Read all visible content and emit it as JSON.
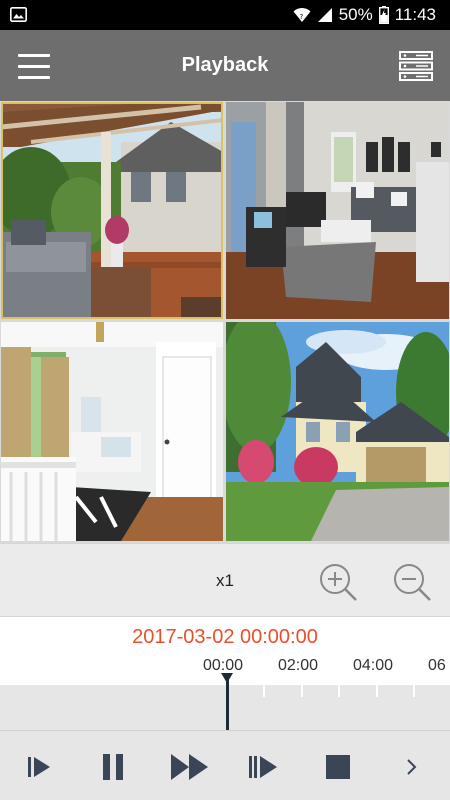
{
  "status_bar": {
    "battery_percent": "50%",
    "time": "11:43",
    "left_icon": "image-icon",
    "icons": [
      "wifi-icon",
      "signal-icon",
      "battery-icon"
    ]
  },
  "app_bar": {
    "title": "Playback",
    "menu_icon": "hamburger-menu-icon",
    "device_icon": "dvr-device-icon"
  },
  "grid": {
    "channels": [
      {
        "scene": "patio pergola"
      },
      {
        "scene": "living room"
      },
      {
        "scene": "bedroom"
      },
      {
        "scene": "house exterior"
      }
    ],
    "active_channel": 1
  },
  "controls": {
    "speed": "x1",
    "zoom_in_icon": "zoom-in-icon",
    "zoom_out_icon": "zoom-out-icon"
  },
  "timeline": {
    "datetime": "2017-03-02 00:00:00",
    "ticks": [
      "00:00",
      "02:00",
      "04:00",
      "06"
    ]
  },
  "toolbar": {
    "buttons": [
      "step-play-icon",
      "pause-icon",
      "fast-forward-icon",
      "frame-step-icon",
      "stop-icon",
      "chevron-right-icon"
    ]
  },
  "colors": {
    "app_bar": "#6e6e6e",
    "timestamp": "#e8502b",
    "active_border": "#d9c166"
  }
}
